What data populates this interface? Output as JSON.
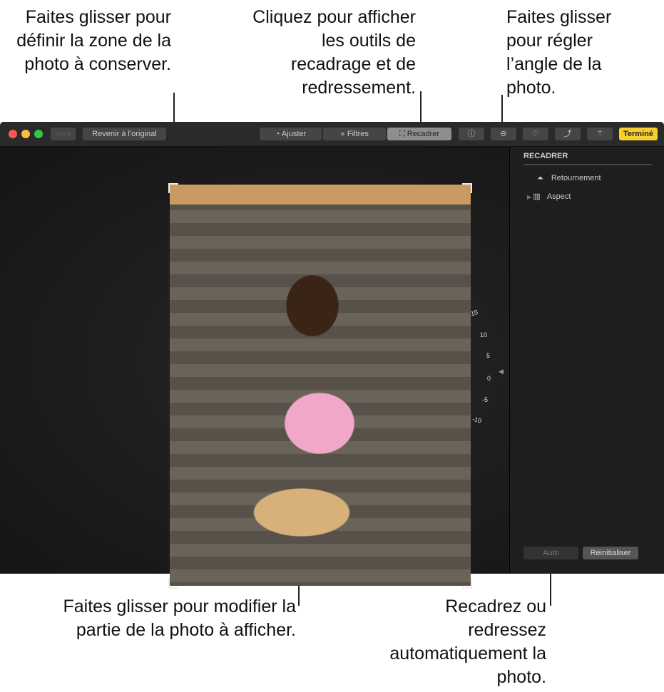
{
  "callouts": {
    "crop_area": "Faites glisser pour définir la zone de la photo à conserver.",
    "crop_tools": "Cliquez pour afficher les outils de recadrage et de redressement.",
    "angle": "Faites glisser pour régler l’angle de la photo.",
    "move_photo": "Faites glisser pour modifier la partie de la photo à afficher.",
    "auto": "Recadrez ou redressez automatiquement la photo."
  },
  "toolbar": {
    "revert": "Revenir à l’original",
    "tabs": [
      {
        "label": "Ajuster",
        "icon": "dial-icon"
      },
      {
        "label": "Filtres",
        "icon": "filters-icon"
      },
      {
        "label": "Recadrer",
        "icon": "crop-icon",
        "selected": true
      }
    ],
    "info": "ⓘ",
    "favorite": "♡",
    "done": "Terminé",
    "done_color": "#f7cf2e"
  },
  "dial": {
    "labels": [
      "15",
      "10",
      "5",
      "0",
      "-5",
      "-10"
    ],
    "value": 0
  },
  "sidebar": {
    "title": "RECADRER",
    "items": [
      {
        "label": "Retournement"
      },
      {
        "label": "Aspect"
      }
    ],
    "auto": "Auto",
    "reset": "Réinitialiser"
  }
}
